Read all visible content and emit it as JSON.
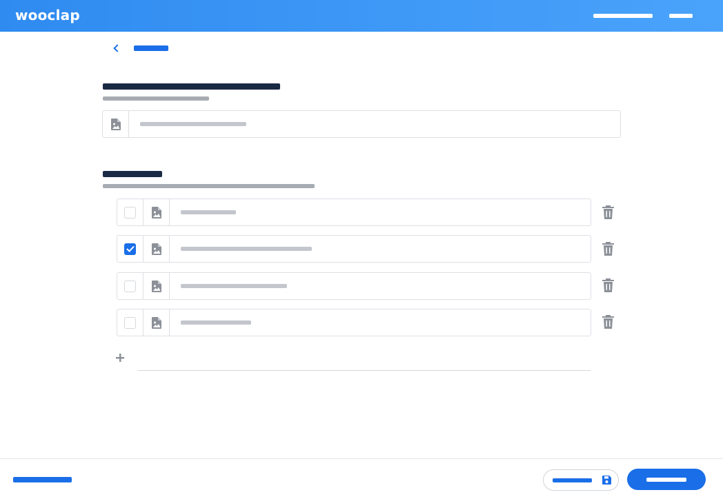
{
  "header": {
    "logo": "wooclap",
    "nav": [
      "",
      ""
    ]
  },
  "back": {
    "label": ""
  },
  "question": {
    "title": "",
    "hint": "",
    "input": {
      "placeholder": "",
      "value": ""
    }
  },
  "answers": {
    "title": "",
    "hint": "",
    "items": [
      {
        "placeholder": "",
        "checked": false
      },
      {
        "placeholder": "",
        "checked": true
      },
      {
        "placeholder": "",
        "checked": false
      },
      {
        "placeholder": "",
        "checked": false
      }
    ]
  },
  "footer": {
    "left_link": "",
    "save_draft": "",
    "primary": ""
  },
  "colors": {
    "brand": "#2f8bf0",
    "accent": "#1a6ee8",
    "heading": "#1b2a44",
    "muted": "#a7abb3",
    "icon": "#8c9098"
  },
  "icons": [
    "chevron-left-icon",
    "image-file-icon",
    "checkbox-icon",
    "check-icon",
    "trash-icon",
    "plus-icon",
    "save-icon"
  ]
}
